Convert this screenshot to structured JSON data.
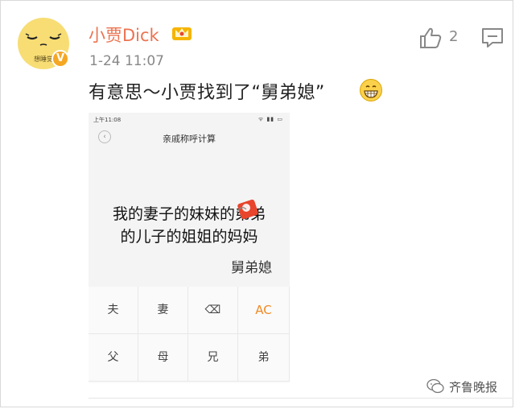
{
  "post": {
    "avatar_text": "想睡觉",
    "verified_badge": "V",
    "username": "小贾Dick",
    "timestamp": "1-24 11:07",
    "like_count": "2",
    "text": "有意思～小贾找到了“舅弟媳”"
  },
  "screenshot": {
    "status_time": "上午11:08",
    "status_icons": "ᯤ ▮▮ ▭",
    "back_glyph": "‹",
    "app_title": "亲戚称呼计算",
    "expression_line1": "我的妻子的妹妹的弟弟",
    "expression_line2": "的儿子的姐姐的妈妈",
    "result": "舅弟媳",
    "keys": [
      "夫",
      "妻",
      "⌫",
      "AC",
      "父",
      "母",
      "兄",
      "弟"
    ]
  },
  "watermark": {
    "text": "齐鲁晚报"
  },
  "colors": {
    "username": "#eb7350",
    "ac_key": "#f08a24",
    "avatar_bg": "#f7dd74"
  }
}
